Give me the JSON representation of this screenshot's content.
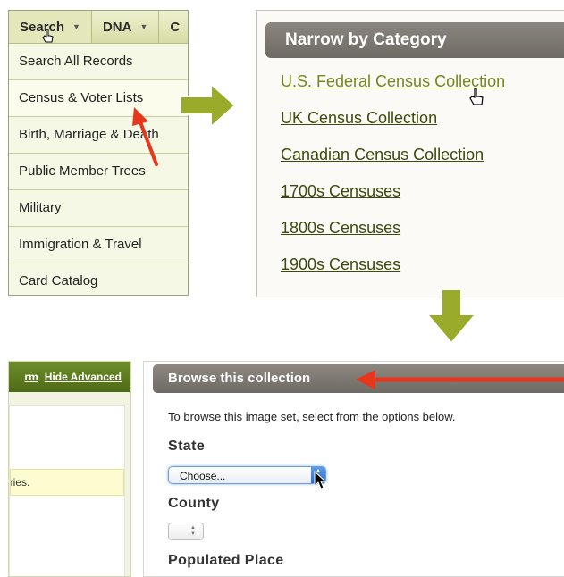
{
  "search_panel": {
    "nav": [
      {
        "label": "Search",
        "active": true
      },
      {
        "label": "DNA",
        "active": false
      },
      {
        "label": "C",
        "active": false
      }
    ],
    "menu_items": [
      "Search All Records",
      "Census & Voter Lists",
      "Birth, Marriage & Death",
      "Public Member Trees",
      "Military",
      "Immigration & Travel",
      "Card Catalog"
    ]
  },
  "category_panel": {
    "title": "Narrow by Category",
    "links": [
      "U.S. Federal Census Collection",
      "UK Census Collection",
      "Canadian Census Collection",
      "1700s Censuses",
      "1800s Censuses",
      "1900s Censuses"
    ]
  },
  "advanced_panel": {
    "link_partial": "rm",
    "hide_advanced": "Hide Advanced",
    "note_partial": "ories."
  },
  "browse_panel": {
    "title": "Browse this collection",
    "intro": "To browse this image set, select from the options below.",
    "state_label": "State",
    "state_select_value": "Choose...",
    "county_label": "County",
    "populated_place_label": "Populated Place"
  },
  "colors": {
    "arrow_green": "#9aaa2a",
    "highlight_arrow_red": "#e8361c",
    "header_gray": "#7a766f",
    "nav_green": "#5f7d22"
  }
}
